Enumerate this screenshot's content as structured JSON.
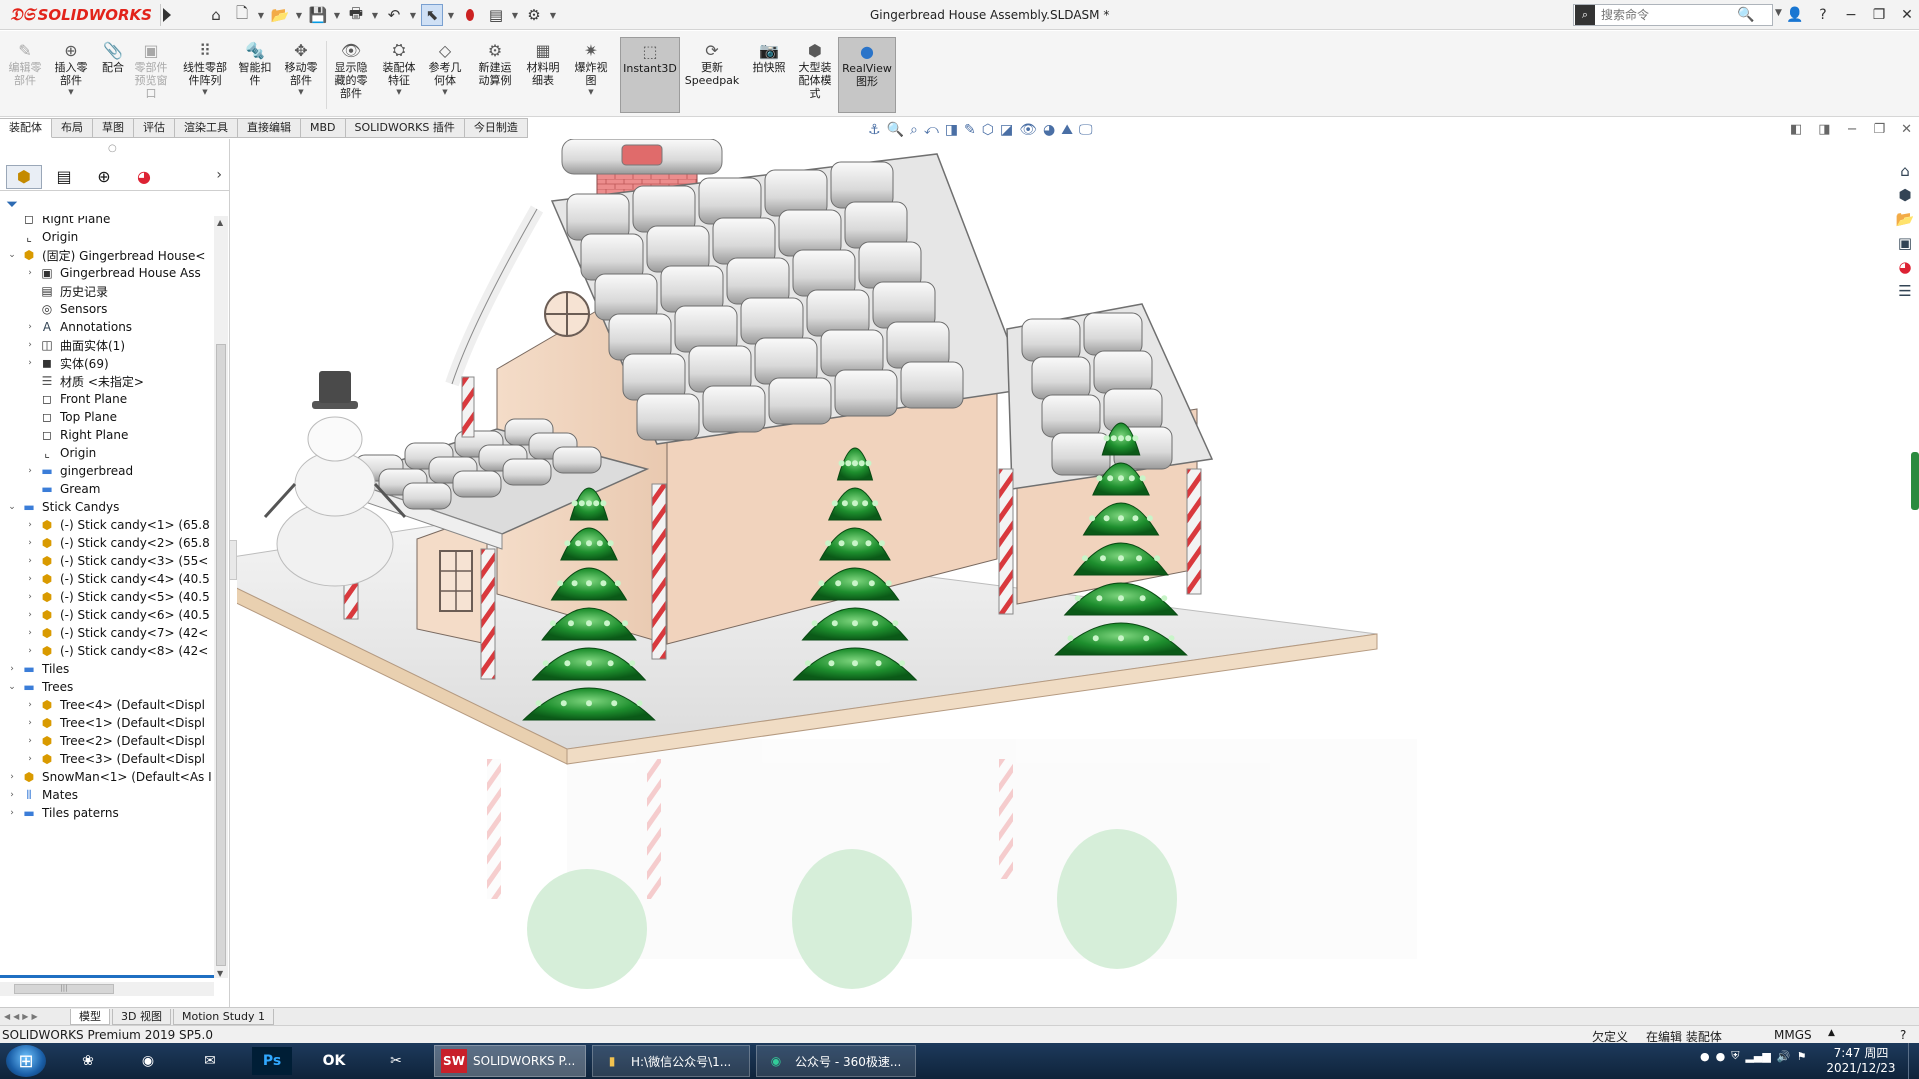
{
  "titlebar": {
    "app_name": "SOLIDWORKS",
    "document_title": "Gingerbread House Assembly.SLDASM *",
    "search_placeholder": "搜索命令",
    "quick_access_icons": [
      "home-icon",
      "new-file-icon",
      "open-icon",
      "save-icon",
      "print-icon",
      "undo-icon",
      "select-icon",
      "rebuild-icon",
      "file-properties-icon",
      "options-icon"
    ],
    "window_controls": [
      "user-icon",
      "help-icon",
      "minimize-icon",
      "restore-icon",
      "close-icon"
    ]
  },
  "ribbon": {
    "buttons": [
      {
        "label": "编辑零\n部件",
        "icon": "edit-component-icon",
        "enabled": false
      },
      {
        "label": "插入零\n部件",
        "icon": "insert-component-icon",
        "enabled": true
      },
      {
        "label": "配合",
        "icon": "mate-icon",
        "enabled": true
      },
      {
        "label": "零部件\n预览窗\n口",
        "icon": "component-preview-icon",
        "enabled": false
      },
      {
        "label": "线性零部\n件阵列",
        "icon": "linear-pattern-icon",
        "enabled": true
      },
      {
        "label": "智能扣\n件",
        "icon": "smart-fastener-icon",
        "enabled": true
      },
      {
        "label": "移动零\n部件",
        "icon": "move-component-icon",
        "enabled": true
      },
      {
        "label": "显示隐\n藏的零\n部件",
        "icon": "show-hidden-icon",
        "enabled": true
      },
      {
        "label": "装配体\n特征",
        "icon": "assembly-feature-icon",
        "enabled": true
      },
      {
        "label": "参考几\n何体",
        "icon": "reference-geometry-icon",
        "enabled": true
      },
      {
        "label": "新建运\n动算例",
        "icon": "motion-study-icon",
        "enabled": true
      },
      {
        "label": "材料明\n细表",
        "icon": "bom-icon",
        "enabled": true
      },
      {
        "label": "爆炸视\n图",
        "icon": "exploded-view-icon",
        "enabled": true
      },
      {
        "label": "Instant3D",
        "icon": "instant3d-icon",
        "enabled": true,
        "active": true
      },
      {
        "label": "更新\nSpeedpak",
        "icon": "speedpak-icon",
        "enabled": true
      },
      {
        "label": "拍快照",
        "icon": "snapshot-icon",
        "enabled": true
      },
      {
        "label": "大型装\n配体模\n式",
        "icon": "large-assembly-icon",
        "enabled": true
      },
      {
        "label": "RealView\n图形",
        "icon": "realview-icon",
        "enabled": true,
        "active": true
      }
    ]
  },
  "command_tabs": [
    "装配体",
    "布局",
    "草图",
    "评估",
    "渲染工具",
    "直接编辑",
    "MBD",
    "SOLIDWORKS 插件",
    "今日制造"
  ],
  "active_command_tab": "装配体",
  "feature_manager": {
    "tabs": [
      "feature-tree-icon",
      "property-manager-icon",
      "configuration-manager-icon",
      "display-manager-icon"
    ],
    "tree": [
      {
        "label": "Right Plane",
        "icon": "plane-icon",
        "expand": ""
      },
      {
        "label": "Origin",
        "icon": "origin-icon",
        "expand": ""
      },
      {
        "label": "(固定) Gingerbread House<",
        "icon": "part-icon",
        "expand": "open"
      },
      {
        "label": "Gingerbread House Ass",
        "icon": "sensor-folder-icon",
        "expand": "closed"
      },
      {
        "label": "历史记录",
        "icon": "history-icon",
        "expand": ""
      },
      {
        "label": "Sensors",
        "icon": "sensors-icon",
        "expand": ""
      },
      {
        "label": "Annotations",
        "icon": "annotations-icon",
        "expand": "closed"
      },
      {
        "label": "曲面实体(1)",
        "icon": "surface-bodies-icon",
        "expand": "closed"
      },
      {
        "label": "实体(69)",
        "icon": "solid-bodies-icon",
        "expand": "closed"
      },
      {
        "label": "材质 <未指定>",
        "icon": "material-icon",
        "expand": ""
      },
      {
        "label": "Front Plane",
        "icon": "plane-icon",
        "expand": ""
      },
      {
        "label": "Top Plane",
        "icon": "plane-icon",
        "expand": ""
      },
      {
        "label": "Right Plane",
        "icon": "plane-icon",
        "expand": ""
      },
      {
        "label": "Origin",
        "icon": "origin-icon",
        "expand": ""
      },
      {
        "label": "gingerbread",
        "icon": "folder-icon",
        "expand": "closed"
      },
      {
        "label": "Gream",
        "icon": "folder-icon",
        "expand": ""
      },
      {
        "label": "Stick Candys",
        "icon": "folder-icon",
        "expand": "open"
      },
      {
        "label": "(-) Stick candy<1> (65.8",
        "icon": "part-icon",
        "expand": "closed"
      },
      {
        "label": "(-) Stick candy<2> (65.8",
        "icon": "part-icon",
        "expand": "closed"
      },
      {
        "label": "(-) Stick candy<3> (55<",
        "icon": "part-icon",
        "expand": "closed"
      },
      {
        "label": "(-) Stick candy<4> (40.5",
        "icon": "part-icon",
        "expand": "closed"
      },
      {
        "label": "(-) Stick candy<5> (40.5",
        "icon": "part-icon",
        "expand": "closed"
      },
      {
        "label": "(-) Stick candy<6> (40.5",
        "icon": "part-icon",
        "expand": "closed"
      },
      {
        "label": "(-) Stick candy<7> (42<",
        "icon": "part-icon",
        "expand": "closed"
      },
      {
        "label": "(-) Stick candy<8> (42<",
        "icon": "part-icon",
        "expand": "closed"
      },
      {
        "label": "Tiles",
        "icon": "folder-icon",
        "expand": "closed"
      },
      {
        "label": "Trees",
        "icon": "folder-icon",
        "expand": "open"
      },
      {
        "label": "Tree<4> (Default<Displ",
        "icon": "subassembly-icon",
        "expand": "closed"
      },
      {
        "label": "Tree<1> (Default<Displ",
        "icon": "subassembly-icon",
        "expand": "closed"
      },
      {
        "label": "Tree<2> (Default<Displ",
        "icon": "subassembly-icon",
        "expand": "closed"
      },
      {
        "label": "Tree<3> (Default<Displ",
        "icon": "subassembly-icon",
        "expand": "closed"
      },
      {
        "label": "SnowMan<1> (Default<As I",
        "icon": "part-icon",
        "expand": "closed"
      },
      {
        "label": "Mates",
        "icon": "mates-icon",
        "expand": "closed"
      },
      {
        "label": "Tiles paterns",
        "icon": "folder-icon",
        "expand": "closed"
      }
    ]
  },
  "bottom_tabs": [
    "模型",
    "3D 视图",
    "Motion Study 1"
  ],
  "active_bottom_tab": "模型",
  "status_bar": {
    "product": "SOLIDWORKS Premium 2019 SP5.0",
    "definition": "欠定义",
    "mode": "在编辑 装配体",
    "units": "MMGS"
  },
  "taskbar": {
    "tasks": [
      {
        "label": "SOLIDWORKS P...",
        "icon": "solidworks-icon",
        "badge": "SW 2019",
        "active": true
      },
      {
        "label": "H:\\微信公众号\\1...",
        "icon": "folder-icon",
        "badge": "",
        "active": false
      },
      {
        "label": "公众号 - 360极速...",
        "icon": "browser-icon",
        "badge": "",
        "active": false
      }
    ],
    "clock_time": "7:47 周四",
    "clock_date": "2021/12/23"
  },
  "colors": {
    "brand_red": "#e2231a",
    "tree_green": "#1f8f2e",
    "candy_red": "#d9393d",
    "gingerbread": "#f2d7c2",
    "icing": "#e9e9e9",
    "chimney_brick": "#e88080"
  }
}
